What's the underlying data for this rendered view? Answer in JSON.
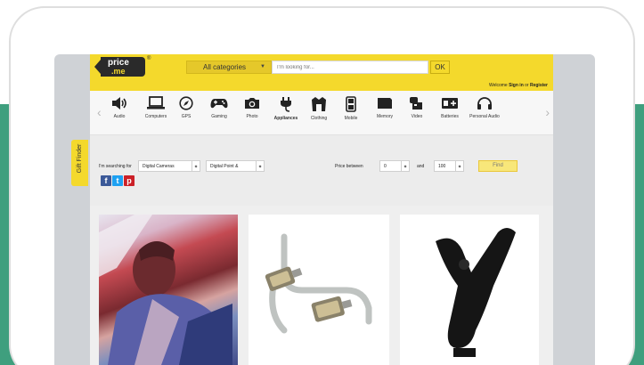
{
  "header": {
    "logo_line1": "price",
    "logo_line2": ".me",
    "logo_registered": "®",
    "category_select": "All categories",
    "search_placeholder": "I'm looking for...",
    "search_button": "OK",
    "welcome_text": "Welcome",
    "sign_in": "Sign in",
    "or_text": "or",
    "register": "Register"
  },
  "categories": [
    {
      "label": "Audio",
      "icon": "speaker-icon"
    },
    {
      "label": "Computers",
      "icon": "laptop-icon"
    },
    {
      "label": "GPS",
      "icon": "compass-icon"
    },
    {
      "label": "Gaming",
      "icon": "gamepad-icon"
    },
    {
      "label": "Photo",
      "icon": "camera-icon"
    },
    {
      "label": "Appliances",
      "icon": "plug-icon"
    },
    {
      "label": "Clothing",
      "icon": "jacket-icon"
    },
    {
      "label": "Mobile",
      "icon": "mobile-phone-icon"
    },
    {
      "label": "Memory",
      "icon": "memory-card-icon"
    },
    {
      "label": "Video",
      "icon": "video-camera-icon"
    },
    {
      "label": "Batteries",
      "icon": "battery-charger-icon"
    },
    {
      "label": "Personal Audio",
      "icon": "headphones-icon"
    }
  ],
  "finder": {
    "tab_label": "Gift Finder",
    "searching_label": "I'm searching for",
    "category_value": "Digital Cameras",
    "subcategory_value": "Digital Point &",
    "price_between_label": "Price between",
    "price_min": "0",
    "and_label": "and",
    "price_max": "100",
    "find_button": "Find"
  },
  "social": {
    "facebook": "f",
    "twitter": "t",
    "pinterest": "p"
  },
  "products": [
    {
      "name": "fashion-photo"
    },
    {
      "name": "vga-cable"
    },
    {
      "name": "microphone-mount"
    }
  ]
}
